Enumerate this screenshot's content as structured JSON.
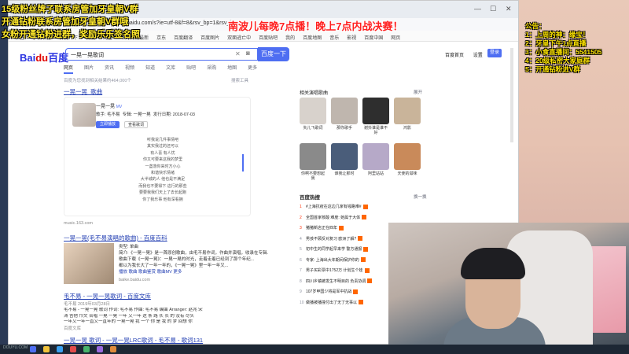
{
  "overlay_left": [
    "15级粉丝牌子联系房管加牙皇朝V群",
    "开通钻粉联系房管加牙皇朝V群哦",
    "女粉开通钻粉进群，奖励乐乐签名照"
  ],
  "top_banner": "南波儿每晚7点播！晚上7点内战决赛！",
  "notice": [
    "公告：",
    "1：上周的神：缘宝！",
    "2：牙皇下午1点直播",
    "3：小食直播间：5541505",
    "4：20级私密大家庭群",
    "5：开通钻粉进V群"
  ],
  "browser": {
    "url": "baidu.com/s?ie=utf-8&f=8&rsv_bp=1&rsv_idx",
    "bookmarks": [
      "书签",
      "手机书签",
      "百度一下",
      "百度",
      "淘宝",
      "华为商城最新",
      "京东",
      "百度翻译",
      "百度图片",
      "双面逃亡中",
      "百度贴吧",
      "我的",
      "百度地图",
      "音乐",
      "影视",
      "百度中国",
      "网页"
    ],
    "search_query": "一晃一晃歌词",
    "search_button": "百度一下",
    "header_links": [
      "百度首页",
      "设置"
    ],
    "login": "登录",
    "nav_tabs": [
      "网页",
      "图片",
      "资讯",
      "视频",
      "知道",
      "文库",
      "贴吧",
      "采购",
      "地图",
      "更多"
    ],
    "result_count": "百度为您找到相关结果约464,000个",
    "tools": "搜索工具",
    "r1_title": "一晃一晃_歌曲",
    "song_name": "一晃一晃",
    "song_tag": "MV",
    "song_singer": "歌手: 毛不易",
    "song_album": "专辑: 一晃一晃",
    "song_date": "发行日期: 2018-07-03",
    "play_btn": "立即播放",
    "lyric_btn": "查看歌词",
    "lyrics": [
      "听我说几件事情吧",
      "其实我过的还可以",
      "有人喜 有人忧",
      "你又可要来这我的梦里",
      "一盏落你来时方小心",
      "和谐快乐情绪",
      "大半城的人 他也是不满足",
      "而我也不要得下 这行的那些",
      "要要我我们天上了去长起跑",
      "你了我乐事 他有深看拥"
    ],
    "r1_source": "music.163.com",
    "r2_title": "一晃一晃(毛不易演唱的歌曲) - 百度百科",
    "r2_lines": [
      "类型: 单曲",
      "简介:《一晃一晃》是一首原创歌曲，由毛不易作词，作曲并演唱，收录在专辑...",
      "歌曲下载《一晃一晃》：一晃一晃的时光，走着走着已经到了那个年纪...",
      "都以为我长大了一年一年的，《一晃一晃》里一年一年又..."
    ],
    "r2_links": "播放  歌曲  歌曲鉴赏  歌曲MV  更多",
    "r2_source": "baike.baidu.com",
    "r3_title": "毛不易 - 一晃一晃歌词 - 百度文库",
    "r3_date": "毛不易 2019年03月28日",
    "r3_lines": [
      "毛不易 - 一晃一晃 歌词 作词: 毛不易 作曲: 毛不易 编曲 Arranger: 赵兆 宋",
      "涛 吉他 邝文 合唱 一晃 一晃 一年 又一年 这 条 路 长 长 的 没有 尽头",
      "一年又一年一直又一直年的 一晃一晃 我 一个 你 是 我 的 梦 回想 你"
    ],
    "r3_source": "百度文库",
    "r4_title": "一晃一晃 歌词 - 一晃一晃LRC歌词 - 毛不易 - 歌词131",
    "rc_title": "相关演唱歌曲",
    "rc_more": "展开",
    "artists": [
      "失儿飞歌词",
      "那你歌手",
      "谢抖谁是谁不好",
      "鸿影",
      "你啊不要想起我",
      "谁我让那时",
      "阿里站站",
      "天使的滋味"
    ],
    "hot_title": "百度热搜",
    "hot_refresh": "换一换",
    "hot_items": [
      {
        "n": "1",
        "t": "#上海抗疫在这边几家有钱路难#"
      },
      {
        "n": "2",
        "t": "全国首家核酸 难度: 她属于大体"
      },
      {
        "n": "3",
        "t": "猪猪新店正在四年"
      },
      {
        "n": "4",
        "t": "男孩不顾反对复习 欧洲了解?"
      },
      {
        "n": "5",
        "t": "初中生的同学起早来学 警方通报"
      },
      {
        "n": "6",
        "t": "专家: 上海出大年期间保护你的"
      },
      {
        "n": "7",
        "t": "男子买彩票中1752万 计划生个娃"
      },
      {
        "n": "8",
        "t": "四川乡镇被发生不明目的 负责协调"
      },
      {
        "n": "9",
        "t": "107岁甲国少将是军中抗战"
      },
      {
        "n": "10",
        "t": "做播被播撞付出了无了无事以"
      }
    ]
  },
  "watermark": "DOUYU.COM"
}
